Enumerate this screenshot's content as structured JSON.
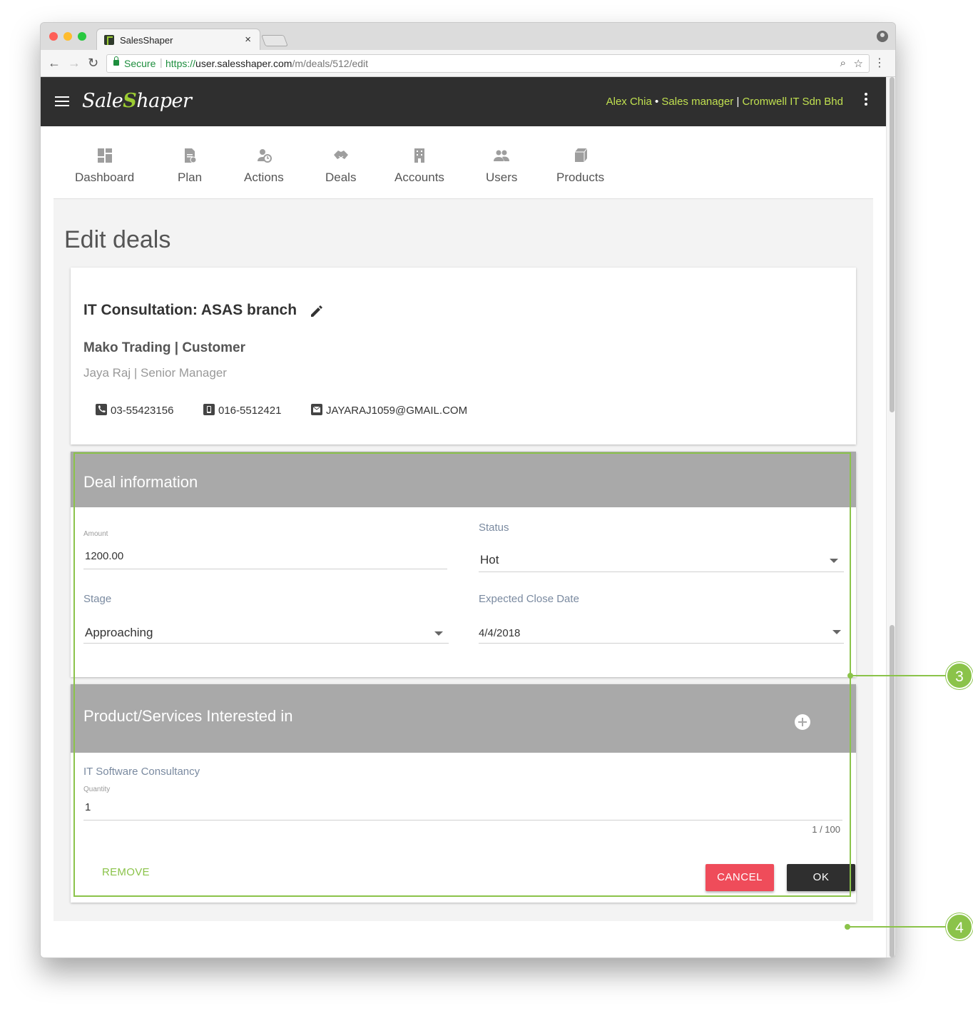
{
  "browser": {
    "tab_title": "SalesShaper",
    "tab_close": "×",
    "secure_label": "Secure",
    "url_scheme": "https://",
    "url_host": "user.salesshaper.com",
    "url_path": "/m/deals/512/edit"
  },
  "app": {
    "logo_text_a": "Sale",
    "logo_mark": "S",
    "logo_text_b": "haper",
    "user_name": "Alex Chia",
    "user_role": "Sales manager",
    "company": "Cromwell IT Sdn Bhd",
    "dot_sep": " • ",
    "pipe_sep": " | "
  },
  "nav": {
    "items": [
      {
        "label": "Dashboard",
        "icon": "dashboard-icon"
      },
      {
        "label": "Plan",
        "icon": "plan-icon"
      },
      {
        "label": "Actions",
        "icon": "actions-icon"
      },
      {
        "label": "Deals",
        "icon": "deals-icon"
      },
      {
        "label": "Accounts",
        "icon": "accounts-icon"
      },
      {
        "label": "Users",
        "icon": "users-icon"
      },
      {
        "label": "Products",
        "icon": "products-icon"
      }
    ]
  },
  "page": {
    "title": "Edit deals"
  },
  "deal": {
    "title": "IT Consultation: ASAS branch",
    "company_line": "Mako Trading | Customer",
    "contact_line": "Jaya Raj | Senior Manager",
    "phone": "03-55423156",
    "mobile": "016-5512421",
    "email": "JAYARAJ1059@GMAIL.COM"
  },
  "deal_info": {
    "header": "Deal information",
    "amount_label": "Amount",
    "amount_value": "1200.00",
    "status_label": "Status",
    "status_value": "Hot",
    "stage_label": "Stage",
    "stage_value": "Approaching",
    "close_date_label": "Expected Close Date",
    "close_date_value": "4/4/2018"
  },
  "products": {
    "header": "Product/Services Interested in",
    "item_name": "IT Software Consultancy",
    "quantity_label": "Quantity",
    "quantity_value": "1",
    "counter": "1 / 100",
    "remove_label": "REMOVE"
  },
  "actions": {
    "cancel_label": "CANCEL",
    "ok_label": "OK"
  },
  "annotations": {
    "marker_3": "3",
    "marker_4": "4"
  },
  "colors": {
    "accent": "#8bc34a",
    "appbar": "#2f2f2f",
    "cancel": "#ef4c5a",
    "section_header": "#a9a9a9"
  }
}
